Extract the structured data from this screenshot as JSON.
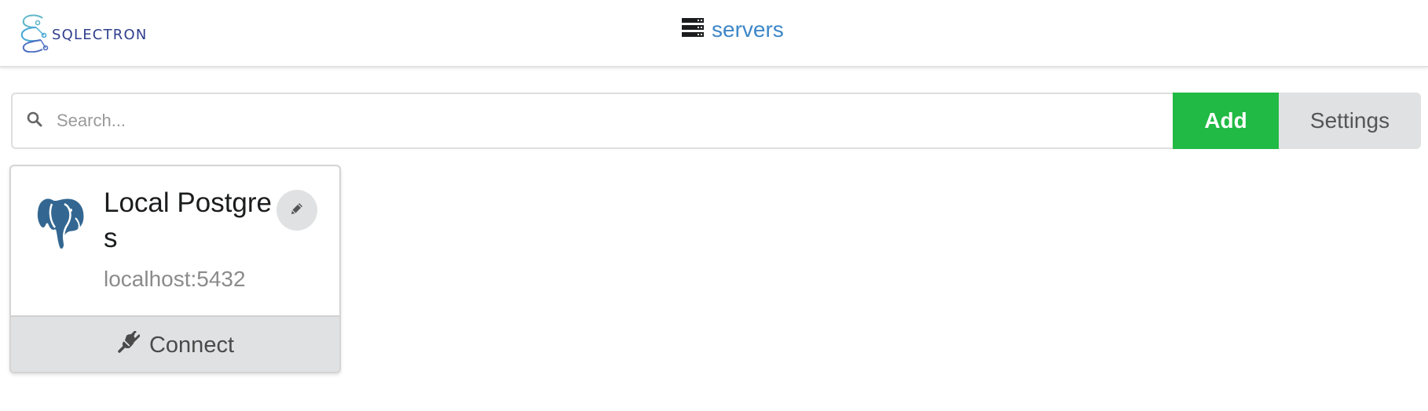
{
  "header": {
    "logo_text": "SQLECTRON",
    "nav_title": "servers",
    "nav_icon": "server-icon"
  },
  "toolbar": {
    "search_placeholder": "Search...",
    "search_value": "",
    "add_label": "Add",
    "settings_label": "Settings"
  },
  "servers": [
    {
      "name": "Local Postgres",
      "address": "localhost:5432",
      "client_icon": "postgresql-elephant-icon",
      "connect_label": "Connect"
    }
  ],
  "colors": {
    "nav_link": "#3d87c8",
    "add_button": "#21ba45",
    "neutral_button": "#e0e1e2",
    "logo_text": "#2f3f8f"
  }
}
